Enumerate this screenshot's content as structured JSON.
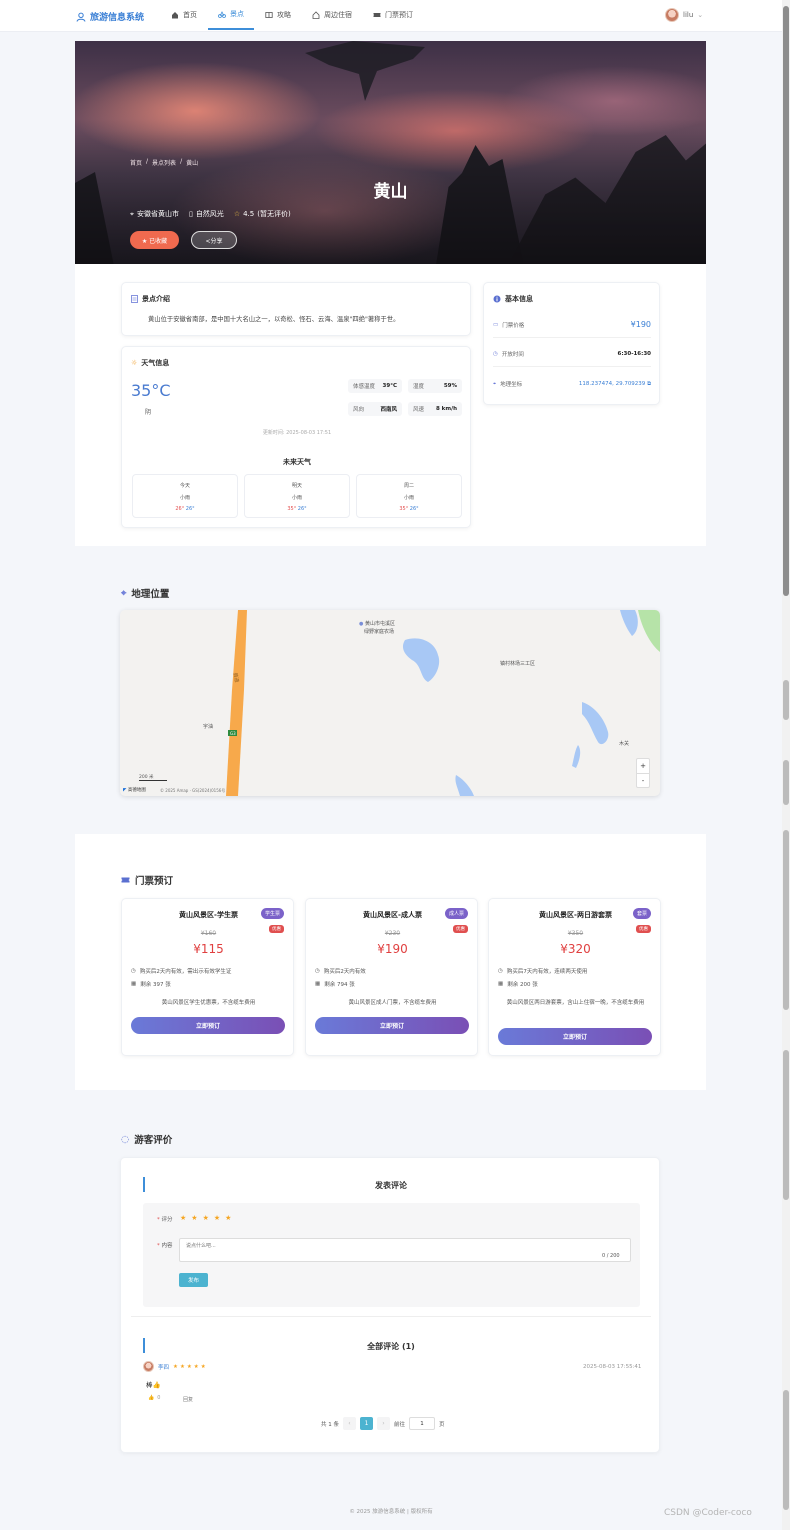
{
  "nav": {
    "brand": "旅游信息系统",
    "items": [
      {
        "label": "首页",
        "icon": "home-icon"
      },
      {
        "label": "景点",
        "icon": "scenic-icon"
      },
      {
        "label": "攻略",
        "icon": "guide-icon"
      },
      {
        "label": "周边住宿",
        "icon": "hotel-icon"
      },
      {
        "label": "门票预订",
        "icon": "ticket-icon"
      }
    ],
    "active": "景点",
    "user": "lilu"
  },
  "hero": {
    "breadcrumb": [
      "首页",
      "景点列表",
      "黄山"
    ],
    "title": "黄山",
    "location": "安徽省黄山市",
    "category": "自然风光",
    "rating": "4.5",
    "rating_note": "(暂无评价)",
    "fav_label": "★ 已收藏",
    "share_label": "<分享"
  },
  "intro": {
    "title": "景点介绍",
    "text": "黄山位于安徽省南部，是中国十大名山之一，以奇松、怪石、云海、温泉\"四绝\"著称于世。"
  },
  "weather": {
    "title": "天气信息",
    "temp": "35°C",
    "condition": "阴",
    "feels_label": "体感温度",
    "feels": "39°C",
    "humidity_label": "湿度",
    "humidity": "59%",
    "wind_label": "风向",
    "wind": "西南风",
    "speed_label": "风速",
    "speed": "8 km/h",
    "updated": "更新时间: 2025-08-03 17:51",
    "future_title": "未来天气",
    "future": [
      {
        "day": "今天",
        "cond": "小雨",
        "high": "26°",
        "low": "26°"
      },
      {
        "day": "明天",
        "cond": "小雨",
        "high": "35°",
        "low": "26°"
      },
      {
        "day": "周二",
        "cond": "小雨",
        "high": "35°",
        "low": "26°"
      }
    ]
  },
  "basic": {
    "title": "基本信息",
    "price_label": "门票价格",
    "price": "¥190",
    "hours_label": "开放时间",
    "hours": "6:30-16:30",
    "coord_label": "地理坐标",
    "coord": "118.237474, 29.709239"
  },
  "map": {
    "title": "地理位置",
    "labels": [
      "黄山市屯溪区",
      "绿野家庭农场",
      "镇村林场三工区",
      "宇油",
      "木关",
      "县道",
      "G3"
    ],
    "scale": "200 米",
    "attribution": "© 2025 Amap · GS(2024)0156号",
    "brand": "高德地图",
    "zoom_in": "+",
    "zoom_out": "-"
  },
  "tickets": {
    "title": "门票预订",
    "items": [
      {
        "name": "黄山风景区-学生票",
        "type": "学生票",
        "hot": "优惠",
        "old": "¥160",
        "price": "¥115",
        "validity": "购买后2天内有效，需出示有效学生证",
        "stock": "剩余 397 张",
        "desc": "黄山风景区学生优惠票，不含缆车费用",
        "btn": "立即预订"
      },
      {
        "name": "黄山风景区-成人票",
        "type": "成人票",
        "hot": "优惠",
        "old": "¥230",
        "price": "¥190",
        "validity": "购买后2天内有效",
        "stock": "剩余 794 张",
        "desc": "黄山风景区成人门票，不含缆车费用",
        "btn": "立即预订"
      },
      {
        "name": "黄山风景区-两日游套票",
        "type": "套票",
        "hot": "优惠",
        "old": "¥350",
        "price": "¥320",
        "validity": "购买后7天内有效，连续两天使用",
        "stock": "剩余 200 张",
        "desc": "黄山风景区两日游套票，含山上住宿一晚，不含缆车费用",
        "btn": "立即预订"
      }
    ]
  },
  "reviews": {
    "title": "游客评价",
    "post_title": "发表评论",
    "rating_label": "评分",
    "content_label": "内容",
    "placeholder": "说点什么吧...",
    "counter": "0 / 200",
    "submit": "发布",
    "list_title": "全部评论 (1)",
    "comment": {
      "user": "李四",
      "time": "2025-08-03 17:55:41",
      "text": "棒👍",
      "likes": "0",
      "reply": "回复"
    },
    "pager": {
      "total": "共 1 条",
      "page": "1",
      "goto": "前往",
      "page_input": "1",
      "unit": "页"
    }
  },
  "footer": "© 2025 旅游信息系统 | 版权所有",
  "watermark": "CSDN @Coder-coco",
  "colors": {
    "accent": "#3d8ed9",
    "price": "#e04040",
    "fav": "#f06a4f",
    "ticket_btn": "#6a7ad8"
  }
}
